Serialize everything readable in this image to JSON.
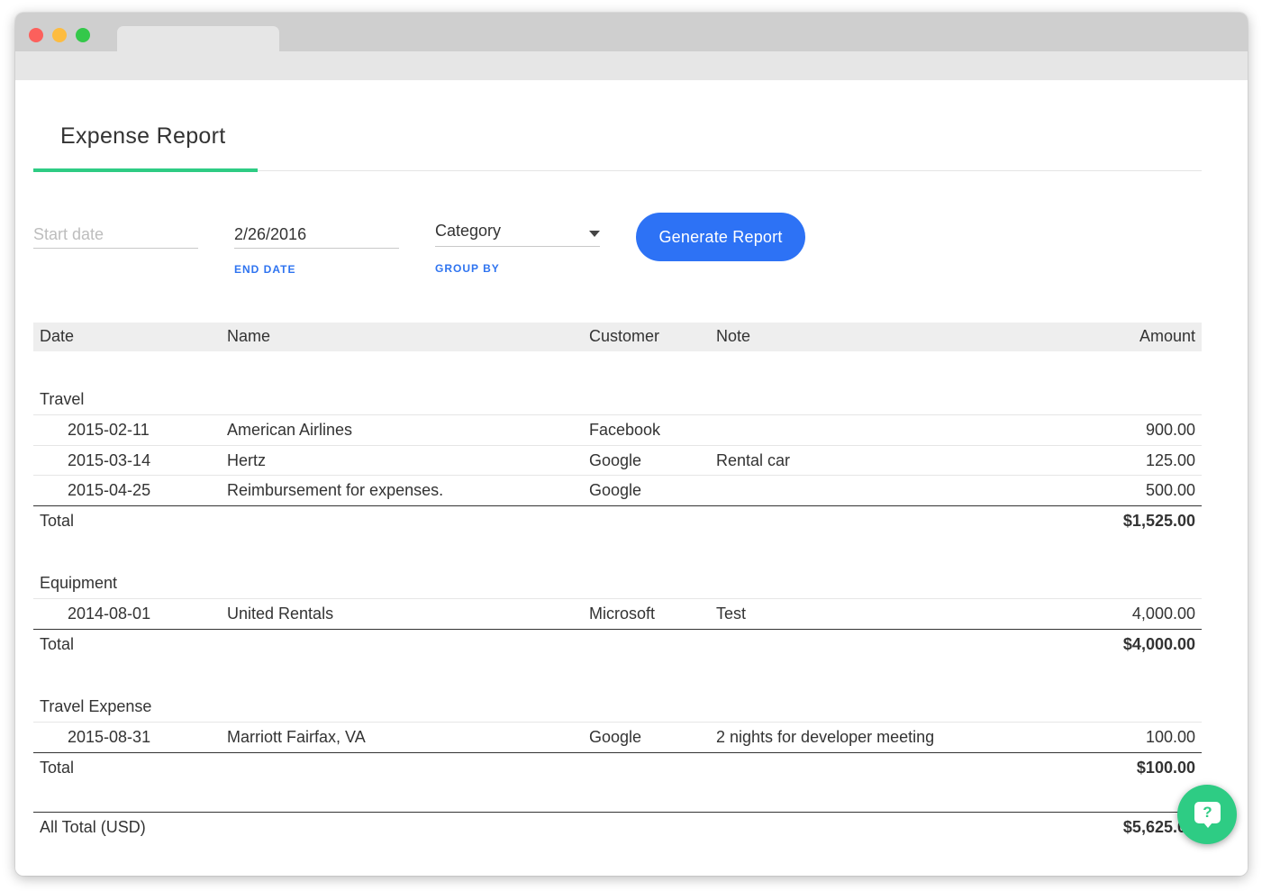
{
  "page": {
    "title": "Expense Report"
  },
  "filters": {
    "start_date": {
      "placeholder": "Start date",
      "value": ""
    },
    "end_date": {
      "value": "2/26/2016",
      "label": "END DATE"
    },
    "group_by": {
      "value": "Category",
      "label": "GROUP BY"
    },
    "generate_label": "Generate Report"
  },
  "table": {
    "headers": {
      "date": "Date",
      "name": "Name",
      "customer": "Customer",
      "note": "Note",
      "amount": "Amount"
    },
    "groups": [
      {
        "label": "Travel",
        "rows": [
          {
            "date": "2015-02-11",
            "name": "American Airlines",
            "customer": "Facebook",
            "note": "",
            "amount": "900.00"
          },
          {
            "date": "2015-03-14",
            "name": "Hertz",
            "customer": "Google",
            "note": "Rental car",
            "amount": "125.00"
          },
          {
            "date": "2015-04-25",
            "name": "Reimbursement for expenses.",
            "customer": "Google",
            "note": "",
            "amount": "500.00"
          }
        ],
        "total_label": "Total",
        "total": "$1,525.00"
      },
      {
        "label": "Equipment",
        "rows": [
          {
            "date": "2014-08-01",
            "name": "United Rentals",
            "customer": "Microsoft",
            "note": "Test",
            "amount": "4,000.00"
          }
        ],
        "total_label": "Total",
        "total": "$4,000.00"
      },
      {
        "label": "Travel Expense",
        "rows": [
          {
            "date": "2015-08-31",
            "name": "Marriott Fairfax, VA",
            "customer": "Google",
            "note": "2 nights for developer meeting",
            "amount": "100.00"
          }
        ],
        "total_label": "Total",
        "total": "$100.00"
      }
    ],
    "all_total_label": "All Total (USD)",
    "all_total": "$5,625.00"
  },
  "help": {
    "icon": "help-chat-icon",
    "glyph": "?"
  },
  "colors": {
    "accent_green": "#2ecc84",
    "primary_blue": "#2d72f5",
    "label_blue": "#2f74f0"
  }
}
